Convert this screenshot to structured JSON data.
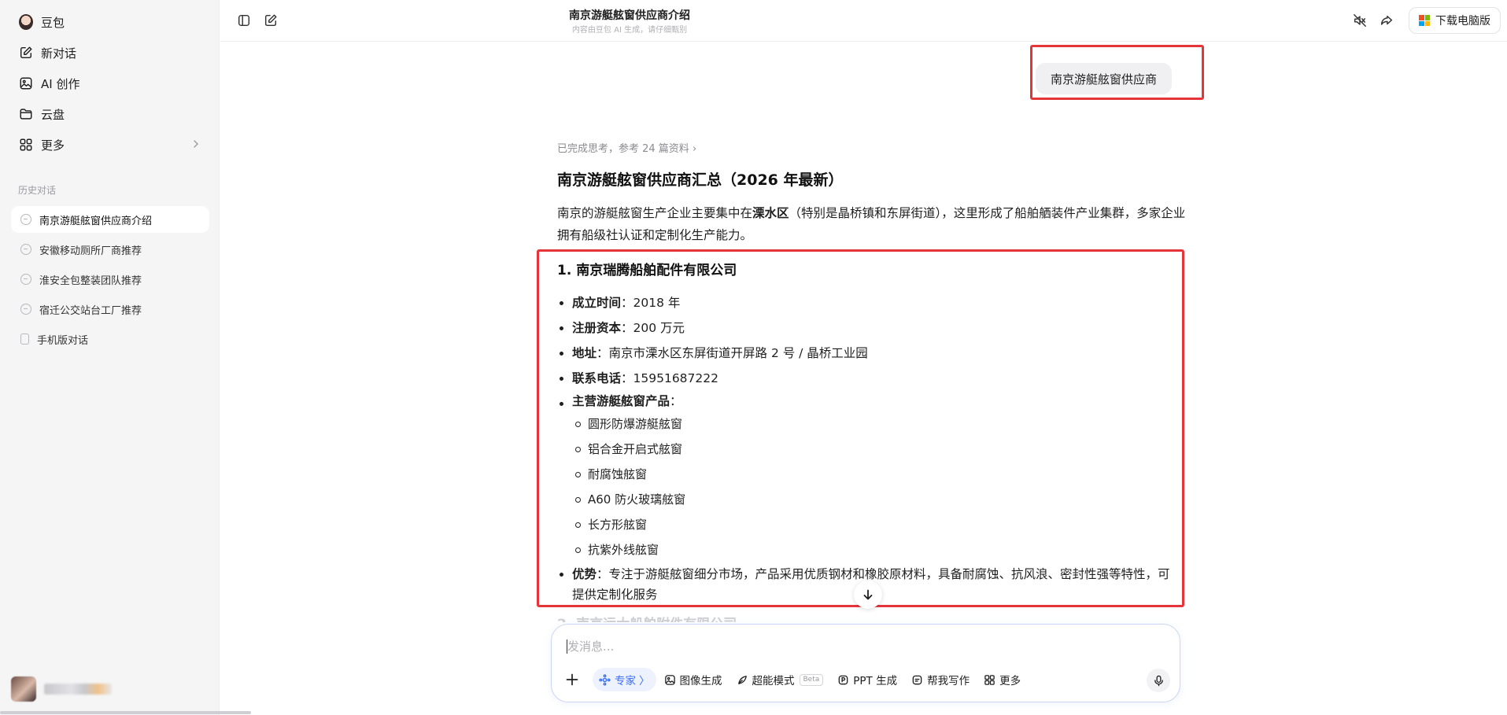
{
  "sidebar": {
    "brand_label": "豆包",
    "nav": [
      {
        "label": "新对话",
        "icon": "edit-icon"
      },
      {
        "label": "AI 创作",
        "icon": "image-icon"
      },
      {
        "label": "云盘",
        "icon": "folder-icon"
      },
      {
        "label": "更多",
        "icon": "grid-icon"
      }
    ],
    "history_title": "历史对话",
    "history": [
      {
        "label": "南京游艇舷窗供应商介绍",
        "active": true
      },
      {
        "label": "安徽移动厕所厂商推荐",
        "active": false
      },
      {
        "label": "淮安全包整装团队推荐",
        "active": false
      },
      {
        "label": "宿迁公交站台工厂推荐",
        "active": false
      },
      {
        "label": "手机版对话",
        "active": false
      }
    ]
  },
  "header": {
    "title": "南京游艇舷窗供应商介绍",
    "subtitle": "内容由豆包 AI 生成，请仔细甄别",
    "download_label": "下载电脑版"
  },
  "chat": {
    "user_message": "南京游艇舷窗供应商",
    "thinking": "已完成思考，参考 24 篇资料",
    "answer_title": "南京游艇舷窗供应商汇总（2026 年最新）",
    "intro_part1": "南京的游艇舷窗生产企业主要集中在",
    "intro_bold": "溧水区",
    "intro_part2": "（特别是晶桥镇和东屏街道），这里形成了船舶舾装件产业集群，多家企业拥有船级社认证和定制化生产能力。",
    "company_title": "1. 南京瑞腾船舶配件有限公司",
    "founded_label": "成立时间",
    "founded_value": "：2018 年",
    "capital_label": "注册资本",
    "capital_value": "：200 万元",
    "address_label": "地址",
    "address_value": "：南京市溧水区东屏街道开屏路 2 号 / 晶桥工业园",
    "phone_label": "联系电话",
    "phone_value": "：15951687222",
    "products_label": "主营游艇舷窗产品",
    "products_colon": "：",
    "products": [
      "圆形防爆游艇舷窗",
      "铝合金开启式舷窗",
      "耐腐蚀舷窗",
      "A60 防火玻璃舷窗",
      "长方形舷窗",
      "抗紫外线舷窗"
    ],
    "advantage_label": "优势",
    "advantage_value": "：专注于游艇舷窗细分市场，产品采用优质钢材和橡胶原材料，具备耐腐蚀、抗风浪、密封性强等特性，可提供定制化服务",
    "next_heading": "2. 南京远大船舶附件有限公司"
  },
  "composer": {
    "placeholder": "发消息...",
    "tools": [
      {
        "label": "专家",
        "suffix": "〉",
        "icon": "expert-icon"
      },
      {
        "label": "图像生成",
        "icon": "image-gen-icon"
      },
      {
        "label": "超能模式",
        "badge": "Beta",
        "icon": "super-mode-icon"
      },
      {
        "label": "PPT 生成",
        "icon": "ppt-icon"
      },
      {
        "label": "帮我写作",
        "icon": "write-icon"
      },
      {
        "label": "更多",
        "icon": "grid-icon"
      }
    ]
  },
  "colors": {
    "highlight_border": "#e5353b",
    "accent": "#3b6ef5",
    "sidebar_bg": "#f5f5f6"
  }
}
